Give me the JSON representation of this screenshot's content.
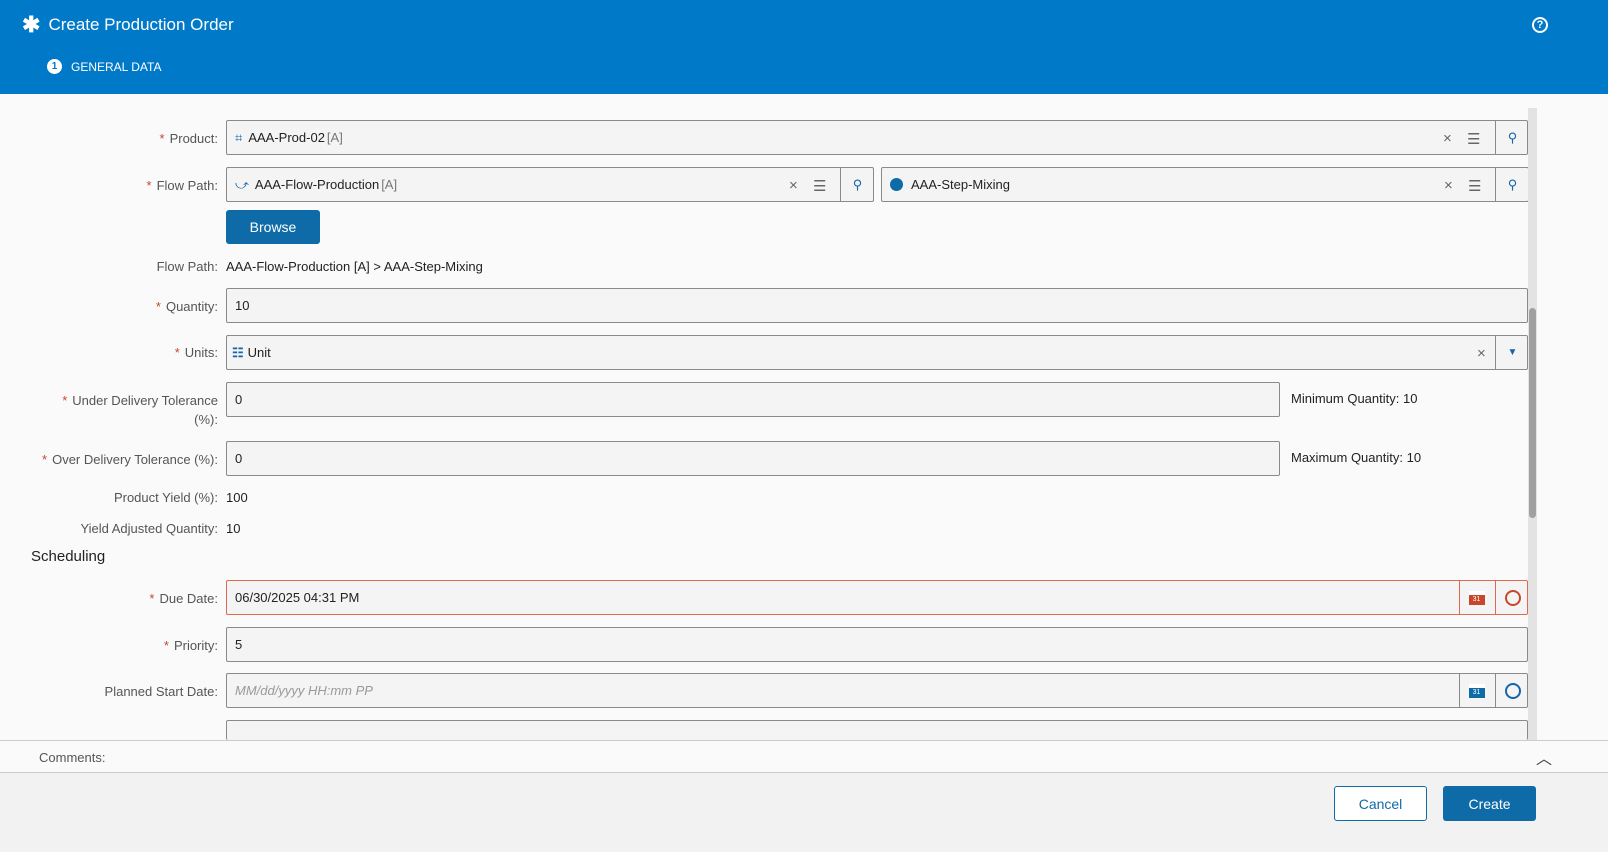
{
  "header": {
    "title": "Create Production Order",
    "step_number": "1",
    "step_label": "GENERAL DATA",
    "help": "?"
  },
  "form": {
    "product_label": "Product:",
    "product_value": "AAA-Prod-02",
    "product_rev": "[A]",
    "flowpath_label": "Flow Path:",
    "flowpath_value": "AAA-Flow-Production",
    "flowpath_rev": "[A]",
    "step_value": "AAA-Step-Mixing",
    "browse": "Browse",
    "flowpath_ro_label": "Flow Path:",
    "flowpath_ro_value": "AAA-Flow-Production [A] > AAA-Step-Mixing",
    "quantity_label": "Quantity:",
    "quantity_value": "10",
    "units_label": "Units:",
    "units_value": "Unit",
    "under_label": "Under Delivery Tolerance",
    "under_label2": "(%):",
    "under_value": "0",
    "min_qty": "Minimum Quantity: 10",
    "over_label": "Over Delivery Tolerance (%):",
    "over_value": "0",
    "max_qty": "Maximum Quantity: 10",
    "yield_label": "Product Yield (%):",
    "yield_value": "100",
    "adj_label": "Yield Adjusted Quantity:",
    "adj_value": "10"
  },
  "scheduling": {
    "title": "Scheduling",
    "due_label": "Due Date:",
    "due_value": "06/30/2025 04:31 PM",
    "calendar_day": "31",
    "priority_label": "Priority:",
    "priority_value": "5",
    "start_label": "Planned Start Date:",
    "start_placeholder": "MM/dd/yyyy HH:mm PP"
  },
  "comments": {
    "label": "Comments:"
  },
  "footer": {
    "cancel": "Cancel",
    "create": "Create"
  },
  "colors": {
    "header": "#0079c8",
    "button": "#0f6ba8",
    "error": "#e06a4f"
  }
}
